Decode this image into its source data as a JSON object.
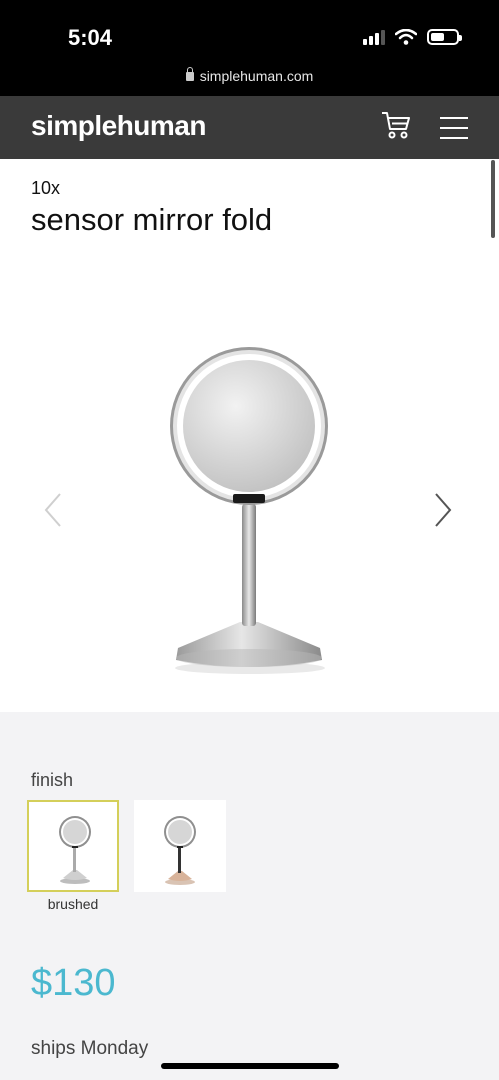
{
  "status_bar": {
    "time": "5:04",
    "url": "simplehuman.com",
    "icons": [
      "signal-icon",
      "wifi-icon",
      "battery-icon"
    ]
  },
  "nav": {
    "logo": "simplehuman",
    "icons": [
      "cart-icon",
      "menu-icon"
    ]
  },
  "product": {
    "subtitle": "10x",
    "title": "sensor mirror fold"
  },
  "carousel": {
    "icons": [
      "chevron-left-icon",
      "chevron-right-icon"
    ]
  },
  "finish": {
    "label": "finish",
    "options": [
      {
        "label": "brushed",
        "selected": true
      },
      {
        "label": "",
        "selected": false
      }
    ]
  },
  "price": "$130",
  "shipping": "ships Monday",
  "colors": {
    "nav_bg": "#3a3a3a",
    "price": "#4bb8cf",
    "selected_border": "#d4cf5a",
    "lower_bg": "#f3f3f5"
  }
}
